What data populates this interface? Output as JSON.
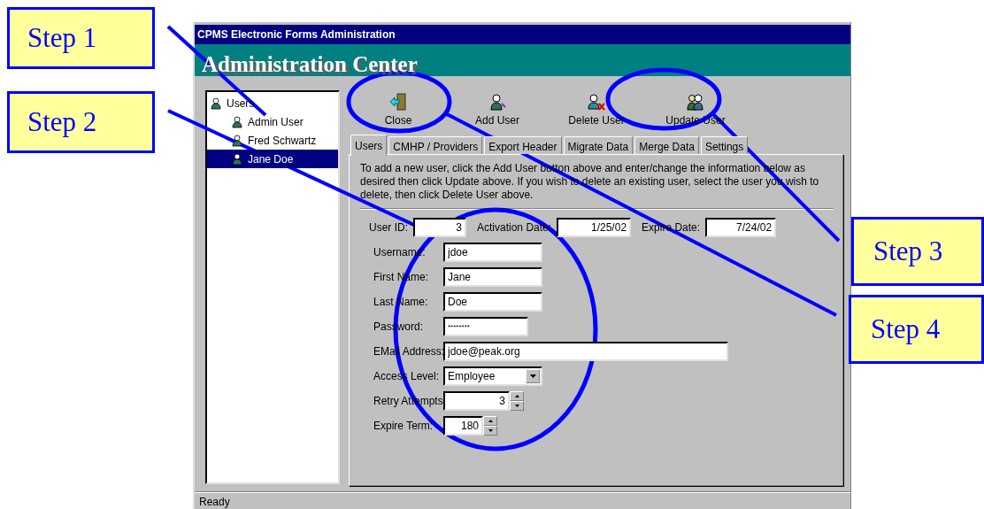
{
  "callouts_left": [
    {
      "label": "Step 1"
    },
    {
      "label": "Step 2"
    }
  ],
  "callouts_right": [
    {
      "label": "Step 3"
    },
    {
      "label": "Step 4"
    }
  ],
  "window": {
    "title": "CPMS Electronic Forms Administration"
  },
  "banner": {
    "title": "Administration Center"
  },
  "tree": {
    "label": "Users",
    "expanded": true,
    "children": [
      {
        "label": "Admin User",
        "selected": false
      },
      {
        "label": "Fred Schwartz",
        "selected": false
      },
      {
        "label": "Jane Doe",
        "selected": true
      }
    ]
  },
  "toolbar": [
    {
      "label": "Close",
      "kind": "close"
    },
    {
      "label": "Add User",
      "kind": "add"
    },
    {
      "label": "Delete User",
      "kind": "delete"
    },
    {
      "label": "Update User",
      "kind": "update"
    }
  ],
  "tabs": [
    {
      "label": "Users",
      "selected": true
    },
    {
      "label": "CMHP / Providers",
      "selected": false
    },
    {
      "label": "Export Header",
      "selected": false
    },
    {
      "label": "Migrate Data",
      "selected": false
    },
    {
      "label": "Merge Data",
      "selected": false
    },
    {
      "label": "Settings",
      "selected": false
    }
  ],
  "instructions": "To add a new user, click the Add User button above and enter/change the information below as desired then click Update above. If you wish to delete an existing user, select the user you wish to delete, then click Delete User above.",
  "id_row": [
    {
      "label": "User ID:",
      "value": "3"
    },
    {
      "label": "Activation Date:",
      "value": "1/25/02"
    },
    {
      "label": "Expire Date:",
      "value": "7/24/02"
    }
  ],
  "fields": [
    {
      "label": "Username:",
      "value": "jdoe",
      "kind": "text"
    },
    {
      "label": "First Name:",
      "value": "Jane",
      "kind": "text"
    },
    {
      "label": "Last Name:",
      "value": "Doe",
      "kind": "text"
    },
    {
      "label": "Password:",
      "value": "********",
      "kind": "password"
    },
    {
      "label": "EMail Address:",
      "value": "jdoe@peak.org",
      "kind": "email"
    },
    {
      "label": "Access Level:",
      "value": "Employee",
      "kind": "select"
    },
    {
      "label": "Retry Attempts:",
      "value": "3",
      "kind": "spinner"
    },
    {
      "label": "Expire Term:",
      "value": "180",
      "kind": "spinner"
    }
  ],
  "status_bar": {
    "text": "Ready"
  }
}
